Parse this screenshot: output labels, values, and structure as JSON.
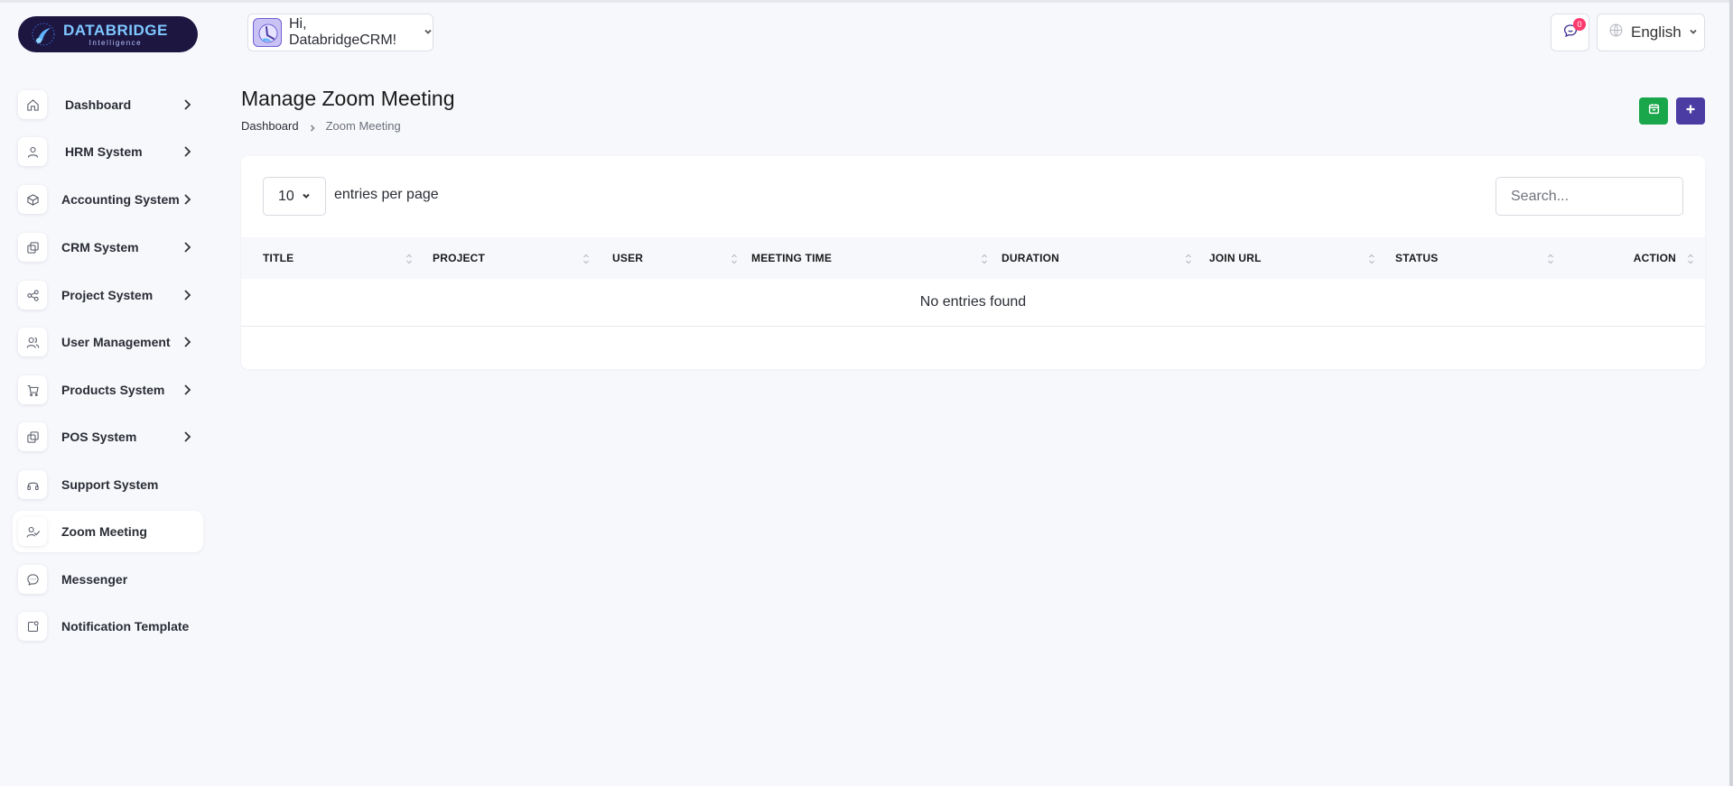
{
  "brand": {
    "name": "DATABRIDGE",
    "tagline": "Intelligence"
  },
  "sidebar": {
    "items": [
      {
        "label": "Dashboard",
        "icon": "home-icon",
        "has_chevron": true,
        "active": false
      },
      {
        "label": "HRM System",
        "icon": "user-icon",
        "has_chevron": true,
        "active": false
      },
      {
        "label": "Accounting System",
        "icon": "box-icon",
        "has_chevron": true,
        "active": false
      },
      {
        "label": "CRM System",
        "icon": "layers-icon",
        "has_chevron": true,
        "active": false
      },
      {
        "label": "Project System",
        "icon": "share-icon",
        "has_chevron": true,
        "active": false
      },
      {
        "label": "User Management",
        "icon": "users-icon",
        "has_chevron": true,
        "active": false
      },
      {
        "label": "Products System",
        "icon": "cart-icon",
        "has_chevron": true,
        "active": false
      },
      {
        "label": "POS System",
        "icon": "layers-icon",
        "has_chevron": true,
        "active": false
      },
      {
        "label": "Support System",
        "icon": "headset-icon",
        "has_chevron": false,
        "active": false
      },
      {
        "label": "Zoom Meeting",
        "icon": "user-check-icon",
        "has_chevron": false,
        "active": true
      },
      {
        "label": "Messenger",
        "icon": "chat-icon",
        "has_chevron": false,
        "active": false
      },
      {
        "label": "Notification Template",
        "icon": "notification-icon",
        "has_chevron": false,
        "active": false
      }
    ]
  },
  "header": {
    "greeting": "Hi, DatabridgeCRM!",
    "message_count": "0",
    "language": "English"
  },
  "page": {
    "title": "Manage Zoom Meeting",
    "breadcrumb": {
      "home": "Dashboard",
      "current": "Zoom Meeting"
    }
  },
  "table": {
    "per_page_value": "10",
    "per_page_label": "entries per page",
    "search_placeholder": "Search...",
    "columns": [
      "TITLE",
      "PROJECT",
      "USER",
      "MEETING TIME",
      "DURATION",
      "JOIN URL",
      "STATUS",
      "ACTION"
    ],
    "empty_message": "No entries found"
  },
  "colors": {
    "accent": "#4a3ca3",
    "success": "#1aa64a",
    "badge": "#ff3a6e",
    "brand_bg": "#1c1640"
  }
}
